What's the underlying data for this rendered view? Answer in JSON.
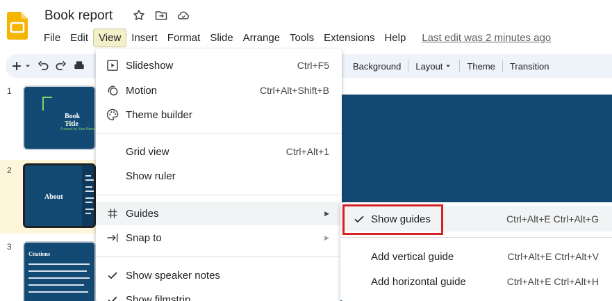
{
  "header": {
    "doc_title": "Book report",
    "last_edit": "Last edit was 2 minutes ago"
  },
  "menubar": {
    "items": [
      "File",
      "Edit",
      "View",
      "Insert",
      "Format",
      "Slide",
      "Arrange",
      "Tools",
      "Extensions",
      "Help"
    ],
    "active": "View"
  },
  "toolbar": {
    "background": "Background",
    "layout": "Layout",
    "theme": "Theme",
    "transition": "Transition"
  },
  "filmstrip": {
    "slides": [
      {
        "number": "1",
        "title": "Book Title",
        "subtitle": "A report by Your Name"
      },
      {
        "number": "2",
        "title": "About",
        "panel_lines": [
          "Title",
          "Book Ti",
          "Author",
          "Thesis",
          "Publish",
          "Public",
          "Gage",
          "2021"
        ]
      },
      {
        "number": "3",
        "title": "Citations"
      }
    ]
  },
  "view_menu": {
    "items": [
      {
        "label": "Slideshow",
        "shortcut": "Ctrl+F5",
        "icon": "slideshow-icon"
      },
      {
        "label": "Motion",
        "shortcut": "Ctrl+Alt+Shift+B",
        "icon": "motion-icon"
      },
      {
        "label": "Theme builder",
        "shortcut": "",
        "icon": "palette-icon"
      },
      {
        "label": "Grid view",
        "shortcut": "Ctrl+Alt+1"
      },
      {
        "label": "Show ruler",
        "shortcut": ""
      },
      {
        "label": "Guides",
        "shortcut": "",
        "icon": "grid-hash-icon",
        "submenu": true
      },
      {
        "label": "Snap to",
        "shortcut": "",
        "icon": "snap-to-icon",
        "submenu": true
      },
      {
        "label": "Show speaker notes",
        "shortcut": "",
        "checked": true
      },
      {
        "label": "Show filmstrip",
        "shortcut": "",
        "checked": true
      }
    ]
  },
  "guides_submenu": {
    "items": [
      {
        "label": "Show guides",
        "shortcut": "Ctrl+Alt+E Ctrl+Alt+G",
        "checked": true
      },
      {
        "label": "Add vertical guide",
        "shortcut": "Ctrl+Alt+E Ctrl+Alt+V"
      },
      {
        "label": "Add horizontal guide",
        "shortcut": "Ctrl+Alt+E Ctrl+Alt+H"
      }
    ]
  },
  "colors": {
    "slide_bg": "#134a73",
    "highlight": "#d92027",
    "accent_green": "#7fd36a",
    "logo_yellow": "#f4b400"
  }
}
